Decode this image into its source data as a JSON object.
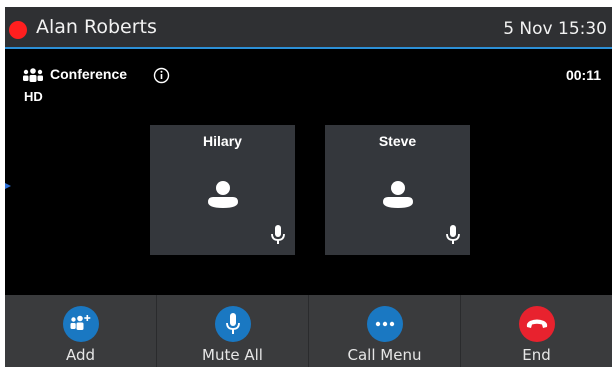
{
  "header": {
    "user_name": "Alan Roberts",
    "datetime": "5 Nov 15:30",
    "status_color": "#ff1f1f",
    "accent_color": "#2c8fd6"
  },
  "call": {
    "type_label": "Conference",
    "timer": "00:11",
    "hd_badge": "HD"
  },
  "participants": [
    {
      "name": "Hilary",
      "icon": "person-icon",
      "mic_icon": "microphone-icon"
    },
    {
      "name": "Steve",
      "icon": "person-icon",
      "mic_icon": "microphone-icon"
    }
  ],
  "softkeys": [
    {
      "label": "Add",
      "icon": "add-participant-icon",
      "color": "#1a78c2"
    },
    {
      "label": "Mute All",
      "icon": "microphone-icon",
      "color": "#1a78c2"
    },
    {
      "label": "Call Menu",
      "icon": "more-icon",
      "color": "#1a78c2"
    },
    {
      "label": "End",
      "icon": "hang-up-icon",
      "color": "#e8222e"
    }
  ]
}
